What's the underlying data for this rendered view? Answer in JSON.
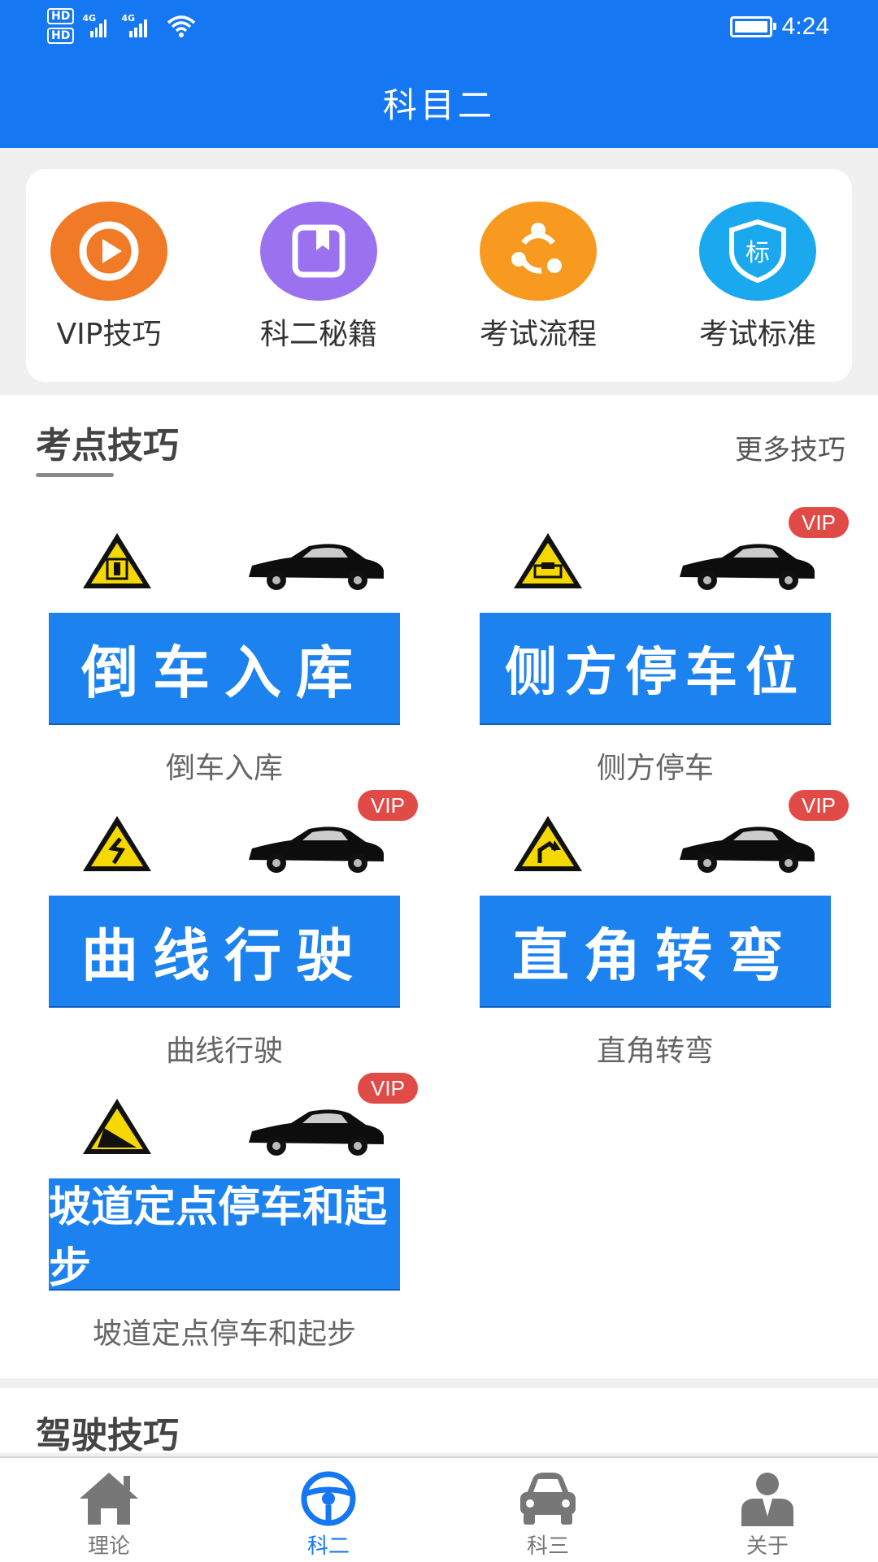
{
  "status": {
    "time": "4:24",
    "hd1": "HD",
    "hd2": "HD",
    "net1": "4G",
    "net2": "4G"
  },
  "header": {
    "title": "科目二"
  },
  "quick_menu": [
    {
      "label": "VIP技巧",
      "icon": "play-circle-icon",
      "color": "#f07a26"
    },
    {
      "label": "科二秘籍",
      "icon": "bookmark-book-icon",
      "color": "#9a72f0"
    },
    {
      "label": "考试流程",
      "icon": "share-flow-icon",
      "color": "#f79a1f"
    },
    {
      "label": "考试标准",
      "icon": "shield-standard-icon",
      "color": "#1aa9ee",
      "icon_text": "标"
    }
  ],
  "tips_section": {
    "title": "考点技巧",
    "more": "更多技巧",
    "vip_label": "VIP",
    "items": [
      {
        "banner": "倒车入库",
        "caption": "倒车入库",
        "vip": false
      },
      {
        "banner": "侧方停车位",
        "caption": "侧方停车",
        "vip": true
      },
      {
        "banner": "曲线行驶",
        "caption": "曲线行驶",
        "vip": true
      },
      {
        "banner": "直角转弯",
        "caption": "直角转弯",
        "vip": true
      },
      {
        "banner": "坡道定点停车和起步",
        "caption": "坡道定点停车和起步",
        "vip": true
      }
    ]
  },
  "driving_section": {
    "title": "驾驶技巧"
  },
  "bottom_nav": [
    {
      "label": "理论",
      "icon": "home-icon",
      "active": false
    },
    {
      "label": "科二",
      "icon": "steering-wheel-icon",
      "active": true
    },
    {
      "label": "科三",
      "icon": "car-icon",
      "active": false
    },
    {
      "label": "关于",
      "icon": "person-icon",
      "active": false
    }
  ],
  "colors": {
    "primary": "#1677f2",
    "banner": "#1c82ef",
    "vip": "#e14b47"
  }
}
